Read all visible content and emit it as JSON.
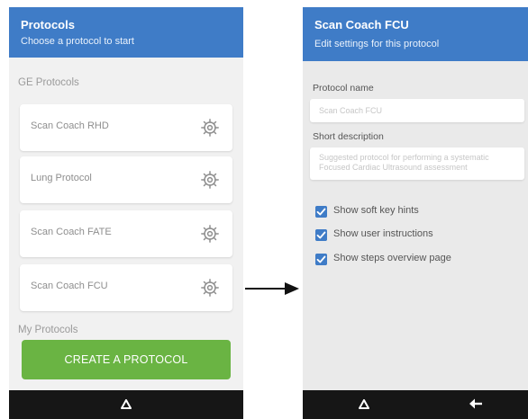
{
  "left_screen": {
    "header": {
      "title": "Protocols",
      "subtitle": "Choose a protocol to start"
    },
    "ge_section_label": "GE Protocols",
    "protocols": [
      {
        "label": "Scan Coach RHD",
        "icon": "gear-icon"
      },
      {
        "label": "Lung Protocol",
        "icon": "gear-icon"
      },
      {
        "label": "Scan Coach FATE",
        "icon": "gear-icon"
      },
      {
        "label": "Scan Coach FCU",
        "icon": "gear-icon"
      }
    ],
    "my_section_label": "My Protocols",
    "create_button_label": "CREATE A PROTOCOL",
    "navbar": {
      "home_icon": "home-triangle-icon"
    }
  },
  "right_screen": {
    "header": {
      "title": "Scan Coach FCU",
      "subtitle": "Edit settings for this protocol"
    },
    "protocol_name_label": "Protocol name",
    "protocol_name_value": "Scan Coach FCU",
    "short_description_label": "Short description",
    "short_description_value": "Suggested protocol for performing a systematic Focused Cardiac Ultrasound assessment",
    "checkboxes": [
      {
        "label": "Show soft key hints",
        "checked": true
      },
      {
        "label": "Show user instructions",
        "checked": true
      },
      {
        "label": "Show steps overview page",
        "checked": true
      }
    ],
    "navbar": {
      "home_icon": "home-triangle-icon",
      "back_icon": "back-arrow-icon"
    }
  },
  "colors": {
    "header_blue": "#3f7cc7",
    "button_green": "#6ab443",
    "navbar_black": "#161616",
    "checkbox_blue": "#3f7cc7"
  }
}
